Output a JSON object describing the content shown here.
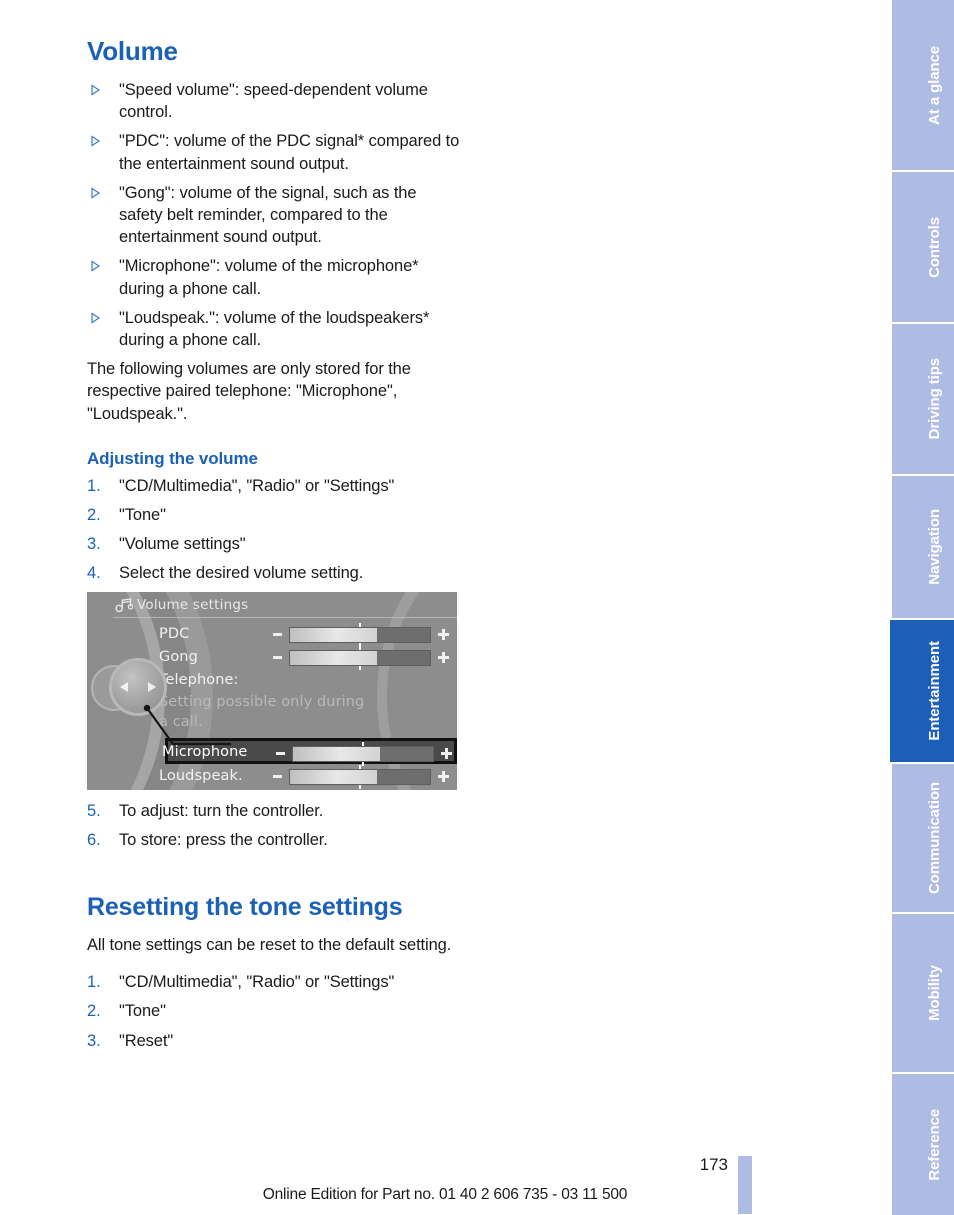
{
  "document": {
    "title": "Volume",
    "accent_color": "#1b61b5",
    "tab_color": "#aebce3",
    "tab_active_color": "#1d5fb8"
  },
  "sections": {
    "volume": {
      "heading": "Volume",
      "bullets": [
        "\"Speed volume\": speed-dependent volume control.",
        "\"PDC\": volume of the PDC signal* compared to the entertainment sound output.",
        "\"Gong\": volume of the signal, such as the safety belt reminder, compared to the entertainment sound output.",
        "\"Microphone\": volume of the microphone* during a phone call.",
        "\"Loudspeak.\": volume of the loudspeakers* during a phone call."
      ],
      "note": "The following volumes are only stored for the respective paired telephone: \"Microphone\", \"Loudspeak.\"."
    },
    "adjusting": {
      "heading": "Adjusting the volume",
      "steps_before": [
        {
          "num": "1.",
          "text": "\"CD/Multimedia\", \"Radio\" or \"Settings\""
        },
        {
          "num": "2.",
          "text": "\"Tone\""
        },
        {
          "num": "3.",
          "text": "\"Volume settings\""
        },
        {
          "num": "4.",
          "text": "Select the desired volume setting."
        }
      ],
      "steps_after": [
        {
          "num": "5.",
          "text": "To adjust: turn the controller."
        },
        {
          "num": "6.",
          "text": "To store: press the controller."
        }
      ]
    },
    "resetting": {
      "heading": "Resetting the tone settings",
      "intro": "All tone settings can be reset to the default setting.",
      "steps": [
        {
          "num": "1.",
          "text": "\"CD/Multimedia\", \"Radio\" or \"Settings\""
        },
        {
          "num": "2.",
          "text": "\"Tone\""
        },
        {
          "num": "3.",
          "text": "\"Reset\""
        }
      ]
    }
  },
  "figure": {
    "screen_title": "Volume settings",
    "title_icon": "music-note-icon",
    "rows": [
      {
        "label": "PDC",
        "type": "slider",
        "fill_percent": 62,
        "selected": false,
        "dim": false
      },
      {
        "label": "Gong",
        "type": "slider",
        "fill_percent": 62,
        "selected": false,
        "dim": false
      },
      {
        "label": "Telephone:",
        "type": "text",
        "selected": false,
        "dim": false
      },
      {
        "label": "Setting possible only during",
        "type": "text",
        "selected": false,
        "dim": true
      },
      {
        "label": "a call.",
        "type": "text",
        "selected": false,
        "dim": true
      },
      {
        "label": "Microphone",
        "type": "slider",
        "fill_percent": 62,
        "selected": true,
        "dim": false
      },
      {
        "label": "Loudspeak.",
        "type": "slider",
        "fill_percent": 62,
        "selected": false,
        "dim": false
      }
    ],
    "controller": "idrive-controller"
  },
  "footer": {
    "page_number": "173",
    "imprint": "Online Edition for Part no. 01 40 2 606 735 - 03 11 500"
  },
  "tabs": [
    {
      "label": "At a glance",
      "active": false
    },
    {
      "label": "Controls",
      "active": false
    },
    {
      "label": "Driving tips",
      "active": false
    },
    {
      "label": "Navigation",
      "active": false
    },
    {
      "label": "Entertainment",
      "active": true
    },
    {
      "label": "Communication",
      "active": false
    },
    {
      "label": "Mobility",
      "active": false
    },
    {
      "label": "Reference",
      "active": false
    }
  ]
}
